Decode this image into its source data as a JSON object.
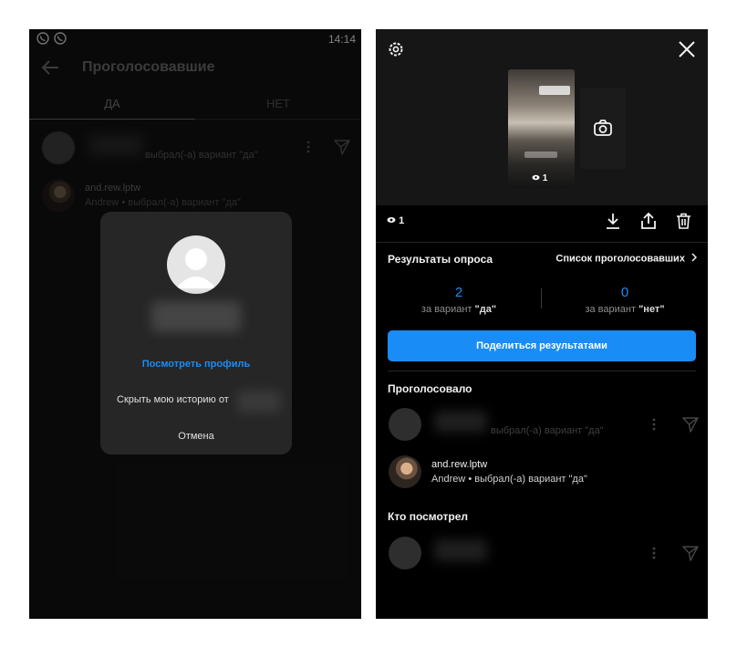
{
  "left": {
    "status": {
      "time": "14:14",
      "icons": [
        "viber-icon",
        "viber-icon"
      ]
    },
    "header": {
      "title": "Проголосовавшие"
    },
    "tabs": [
      {
        "label": "ДА"
      },
      {
        "label": "НЕТ"
      }
    ],
    "voters": [
      {
        "username": "",
        "subtitle": "выбрал(-а) вариант \"да\""
      },
      {
        "username": "and.rew.lptw",
        "subtitle": "Andrew • выбрал(-а) вариант \"да\""
      }
    ],
    "dialog": {
      "view_profile": "Посмотреть профиль",
      "hide_story": "Скрыть мою историю от",
      "cancel": "Отмена"
    }
  },
  "right": {
    "preview": {
      "views": "1"
    },
    "views_count": "1",
    "poll": {
      "title": "Результаты опроса",
      "voters_link": "Список проголосовавших",
      "results": [
        {
          "count": "2",
          "label_prefix": "за вариант",
          "option": "\"да\""
        },
        {
          "count": "0",
          "label_prefix": "за вариант",
          "option": "\"нет\""
        }
      ],
      "share_button": "Поделиться результатами"
    },
    "voted": {
      "title": "Проголосовало",
      "items": [
        {
          "username": "",
          "subtitle": "выбрал(-а) вариант \"да\""
        },
        {
          "username": "and.rew.lptw",
          "subtitle": "Andrew • выбрал(-а) вариант \"да\""
        }
      ]
    },
    "viewed": {
      "title": "Кто посмотрел"
    }
  },
  "colors": {
    "accent": "#1a8cf6",
    "background": "#000000",
    "muted": "#8e8e8e"
  }
}
